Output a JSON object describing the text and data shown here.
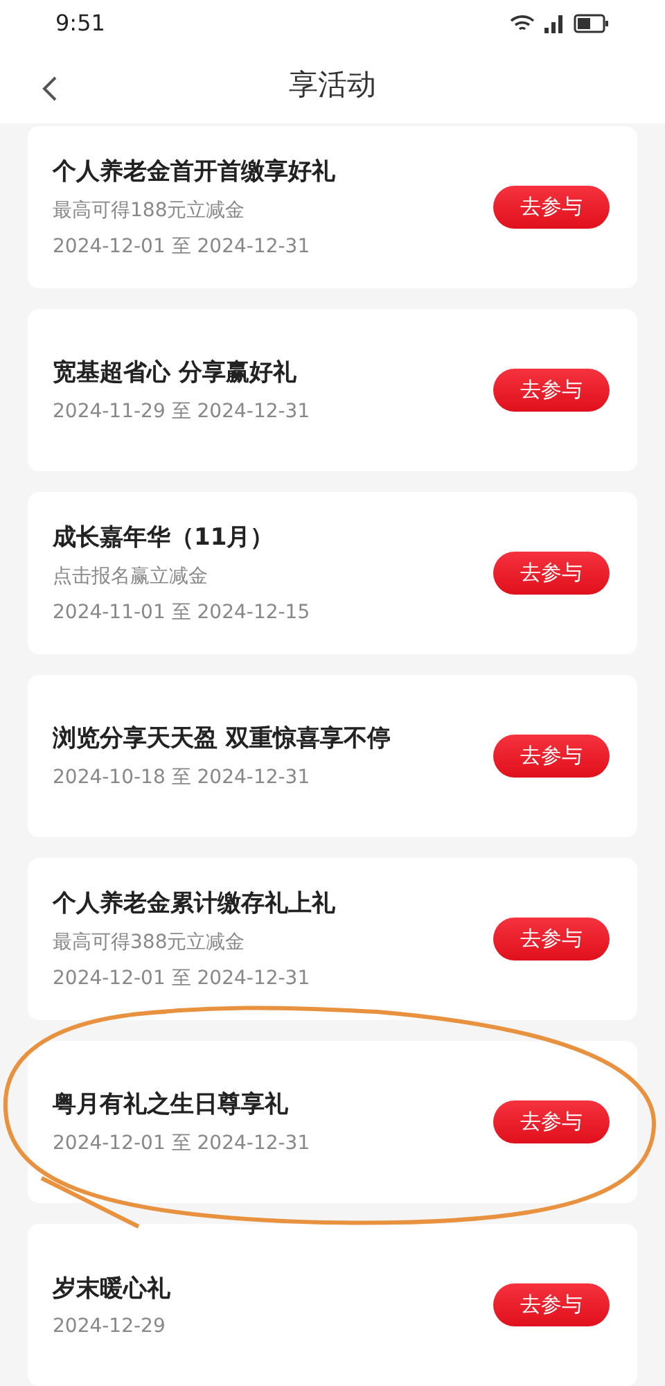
{
  "status_bar": {
    "time": "9:51"
  },
  "header": {
    "title": "享活动"
  },
  "activities": [
    {
      "title": "个人养老金首开首缴享好礼",
      "subtitle": "最高可得188元立减金",
      "dates": "2024-12-01 至 2024-12-31",
      "button": "去参与"
    },
    {
      "title": "宽基超省心 分享赢好礼",
      "dates": "2024-11-29 至 2024-12-31",
      "button": "去参与"
    },
    {
      "title": "成长嘉年华（11月）",
      "subtitle": "点击报名赢立减金",
      "dates": "2024-11-01 至 2024-12-15",
      "button": "去参与"
    },
    {
      "title": "浏览分享天天盈 双重惊喜享不停",
      "dates": "2024-10-18 至 2024-12-31",
      "button": "去参与"
    },
    {
      "title": "个人养老金累计缴存礼上礼",
      "subtitle": "最高可得388元立减金",
      "dates": "2024-12-01 至 2024-12-31",
      "button": "去参与"
    },
    {
      "title": "粤月有礼之生日尊享礼",
      "dates": "2024-12-01 至 2024-12-31",
      "button": "去参与"
    },
    {
      "title": "岁末暖心礼",
      "dates": "2024-12-29",
      "button": "去参与"
    }
  ]
}
